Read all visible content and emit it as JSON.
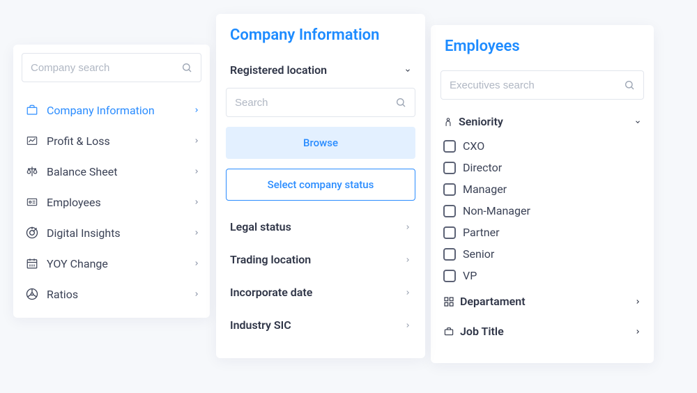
{
  "left": {
    "search_placeholder": "Company search",
    "items": [
      {
        "label": "Company Information",
        "icon": "briefcase-icon",
        "active": true
      },
      {
        "label": "Profit & Loss",
        "icon": "chart-line-icon",
        "active": false
      },
      {
        "label": "Balance Sheet",
        "icon": "scales-icon",
        "active": false
      },
      {
        "label": "Employees",
        "icon": "id-card-icon",
        "active": false
      },
      {
        "label": "Digital Insights",
        "icon": "target-icon",
        "active": false
      },
      {
        "label": "YOY Change",
        "icon": "calendar-icon",
        "active": false
      },
      {
        "label": "Ratios",
        "icon": "steering-icon",
        "active": false
      }
    ]
  },
  "mid": {
    "title": "Company Information",
    "registered_label": "Registered location",
    "search_placeholder": "Search",
    "browse_label": "Browse",
    "select_status_label": "Select company status",
    "filters": [
      {
        "label": "Legal status"
      },
      {
        "label": "Trading location"
      },
      {
        "label": "Incorporate date"
      },
      {
        "label": "Industry SIC"
      }
    ]
  },
  "right": {
    "title": "Employees",
    "search_placeholder": "Executives search",
    "seniority_label": "Seniority",
    "seniority_options": [
      {
        "label": "CXO"
      },
      {
        "label": "Director"
      },
      {
        "label": "Manager"
      },
      {
        "label": "Non-Manager"
      },
      {
        "label": "Partner"
      },
      {
        "label": "Senior"
      },
      {
        "label": "VP"
      }
    ],
    "department_label": "Departament",
    "jobtitle_label": "Job Title"
  }
}
